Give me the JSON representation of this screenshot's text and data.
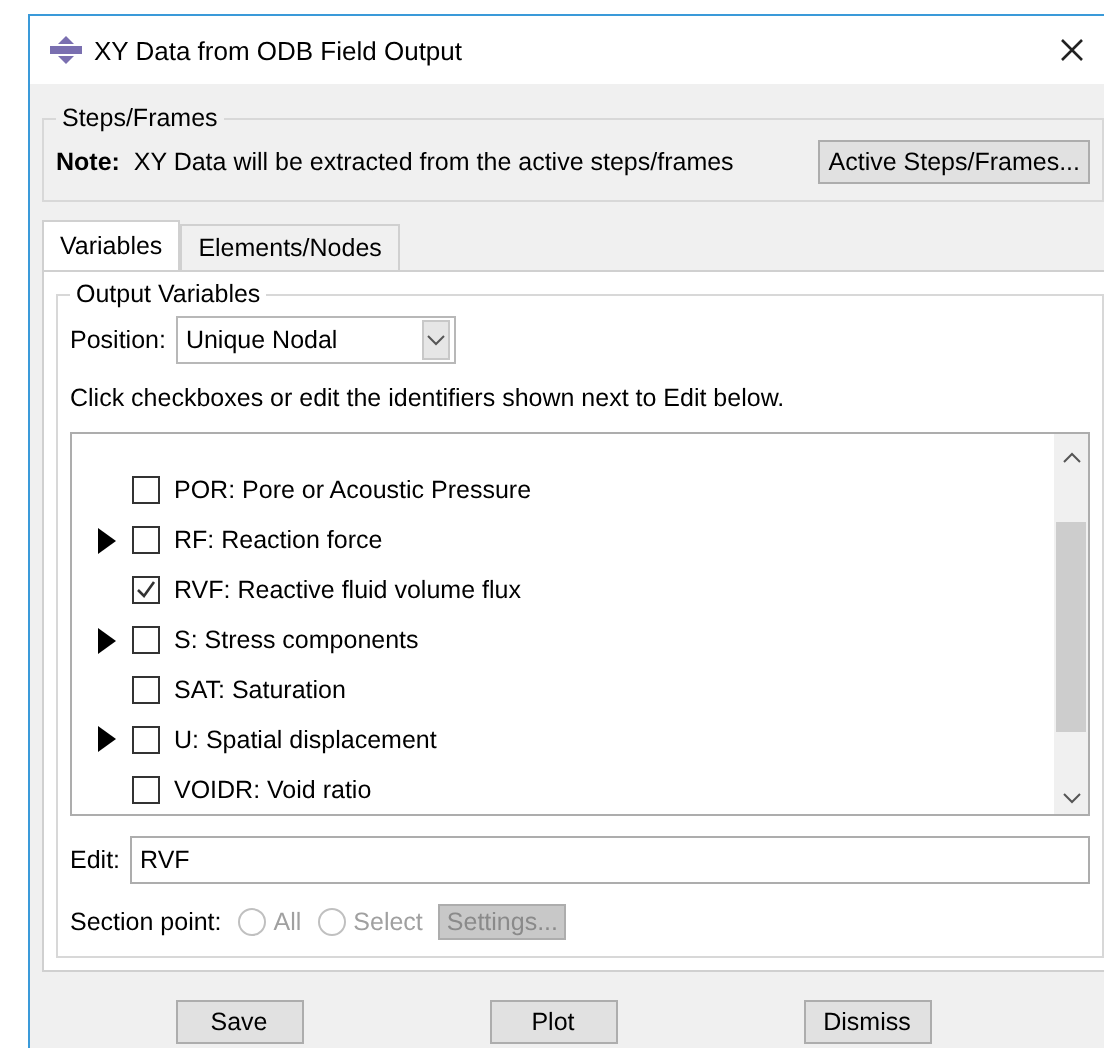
{
  "window": {
    "title": "XY Data from ODB Field Output"
  },
  "steps_frames": {
    "legend": "Steps/Frames",
    "note_label": "Note:",
    "note": "XY Data will be extracted from the active steps/frames",
    "button": "Active Steps/Frames..."
  },
  "tabs": [
    {
      "label": "Variables",
      "selected": true
    },
    {
      "label": "Elements/Nodes",
      "selected": false
    }
  ],
  "output_variables": {
    "legend": "Output Variables",
    "position": {
      "label": "Position:",
      "value": "Unique Nodal"
    },
    "instruction": "Click checkboxes or edit the identifiers shown next to Edit below.",
    "variables": [
      {
        "label": "POR: Pore or Acoustic Pressure",
        "expandable": false,
        "checked": false
      },
      {
        "label": "RF: Reaction force",
        "expandable": true,
        "checked": false
      },
      {
        "label": "RVF: Reactive fluid volume flux",
        "expandable": false,
        "checked": true
      },
      {
        "label": "S: Stress components",
        "expandable": true,
        "checked": false
      },
      {
        "label": "SAT: Saturation",
        "expandable": false,
        "checked": false
      },
      {
        "label": "U: Spatial displacement",
        "expandable": true,
        "checked": false
      },
      {
        "label": "VOIDR: Void ratio",
        "expandable": false,
        "checked": false
      }
    ],
    "edit": {
      "label": "Edit:",
      "value": "RVF"
    },
    "section_point": {
      "label": "Section point:",
      "options": [
        {
          "label": "All",
          "selected": false,
          "disabled": true
        },
        {
          "label": "Select",
          "selected": false,
          "disabled": true
        }
      ],
      "settings": {
        "label": "Settings...",
        "disabled": true
      }
    }
  },
  "buttons": [
    "Save",
    "Plot",
    "Dismiss"
  ]
}
